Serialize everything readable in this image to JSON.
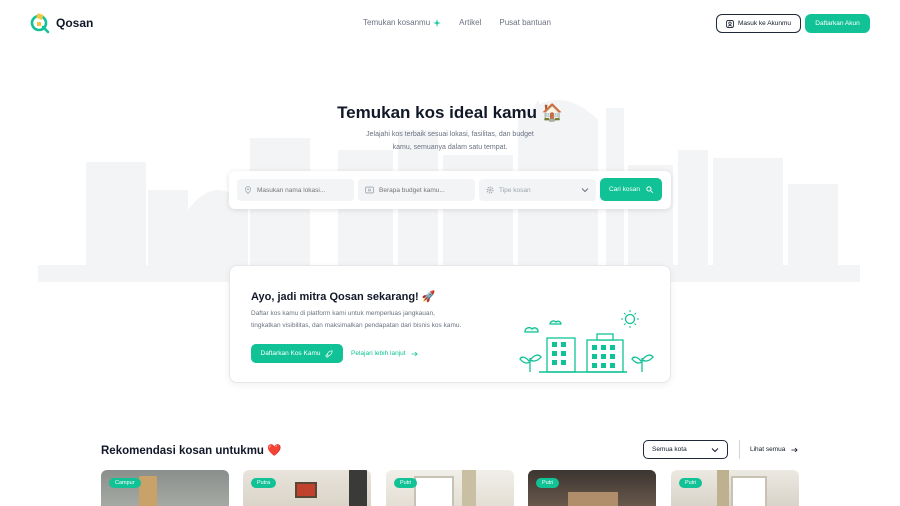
{
  "nav": {
    "logo_text": "Qosan",
    "links": [
      "Temukan kosanmu",
      "Artikel",
      "Pusat bantuan"
    ],
    "login_label": "Masuk ke Akunmu",
    "register_label": "Daftarkan Akun"
  },
  "hero": {
    "title": "Temukan kos ideal kamu 🏠",
    "subtitle_line1": "Jelajahi kos terbaik sesuai lokasi, fasilitas, dan budget",
    "subtitle_line2": "kamu, semuanya dalam satu tempat."
  },
  "search": {
    "location_placeholder": "Masukan nama lokasi...",
    "budget_placeholder": "Berapa budget kamu...",
    "type_placeholder": "Tipe kosan",
    "button_label": "Cari kosan"
  },
  "partner": {
    "title": "Ayo, jadi mitra Qosan sekarang! 🚀",
    "desc_line1": "Daftar kos kamu di platform kami untuk memperluas jangkauan,",
    "desc_line2": "tingkatkan visibilitas, dan maksimalkan pendapatan dari bisnis kos kamu.",
    "button_label": "Daftarkan Kos Kamu",
    "link_label": "Pelajari lebih lanjut"
  },
  "recommendations": {
    "title": "Rekomendasi kosan untukmu ❤️",
    "city_select": "Semua kota",
    "see_all_label": "Lihat semua",
    "cards": [
      {
        "badge": "Campur"
      },
      {
        "badge": "Putra"
      },
      {
        "badge": "Putri"
      },
      {
        "badge": "Putri"
      },
      {
        "badge": "Putri"
      }
    ]
  },
  "colors": {
    "accent": "#10c295",
    "text": "#111827",
    "muted": "#6b7280"
  }
}
